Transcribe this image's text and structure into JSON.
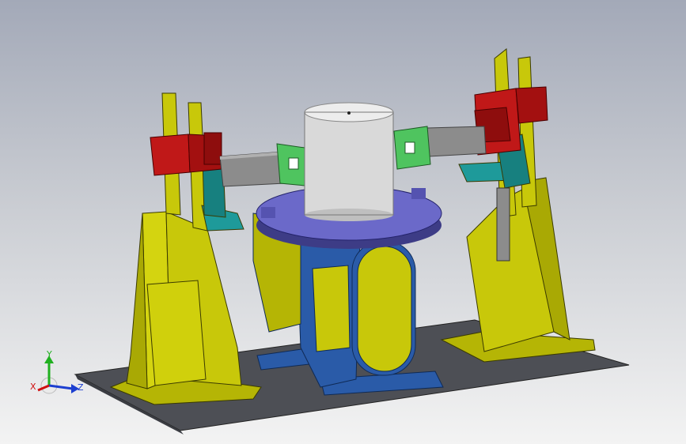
{
  "viewport": {
    "background_top": "#a3a9b8",
    "background_bottom": "#f3f3f3"
  },
  "colors": {
    "base_plate": "#4d4f55",
    "column_yellow": "#c8c80a",
    "positioner_blue": "#2a5ba8",
    "turntable_purple": "#6b69c9",
    "workpiece_gray": "#d9d9d9",
    "gearbox_red": "#c01818",
    "bracket_teal": "#1e9a9a",
    "clamp_green": "#4fc45f",
    "arm_gray": "#8c8c8c"
  },
  "triad": {
    "x_label": "X",
    "y_label": "Y",
    "z_label": "Z",
    "x_color": "#d01010",
    "y_color": "#20b020",
    "z_color": "#1c3fd0"
  }
}
